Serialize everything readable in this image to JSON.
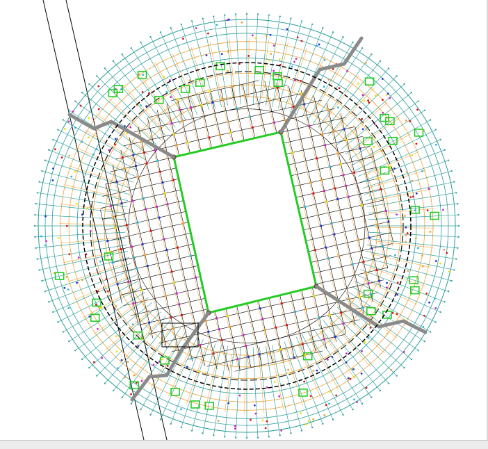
{
  "drawing": {
    "kind": "stadium-structural-plan",
    "colors": {
      "background": "#ffffff",
      "outer_ring_teal": "#2a9d9a",
      "radial_orange": "#f0a030",
      "grid_black": "#000000",
      "beam_green": "#22cc22",
      "column_red": "#dd1111",
      "column_blue": "#1a33dd",
      "column_magenta": "#cc22cc",
      "yellow_marks": "#f0e000",
      "cyan_marks": "#22b8e0",
      "corner_wall_gray": "#8a8a8a",
      "frame_gray": "#d9d9d9"
    },
    "elements": [
      "outer-ring",
      "radial-grid",
      "rectangular-grid",
      "central-void",
      "corner-walls",
      "pitch-edge-beam",
      "site-boundary-lines"
    ]
  }
}
